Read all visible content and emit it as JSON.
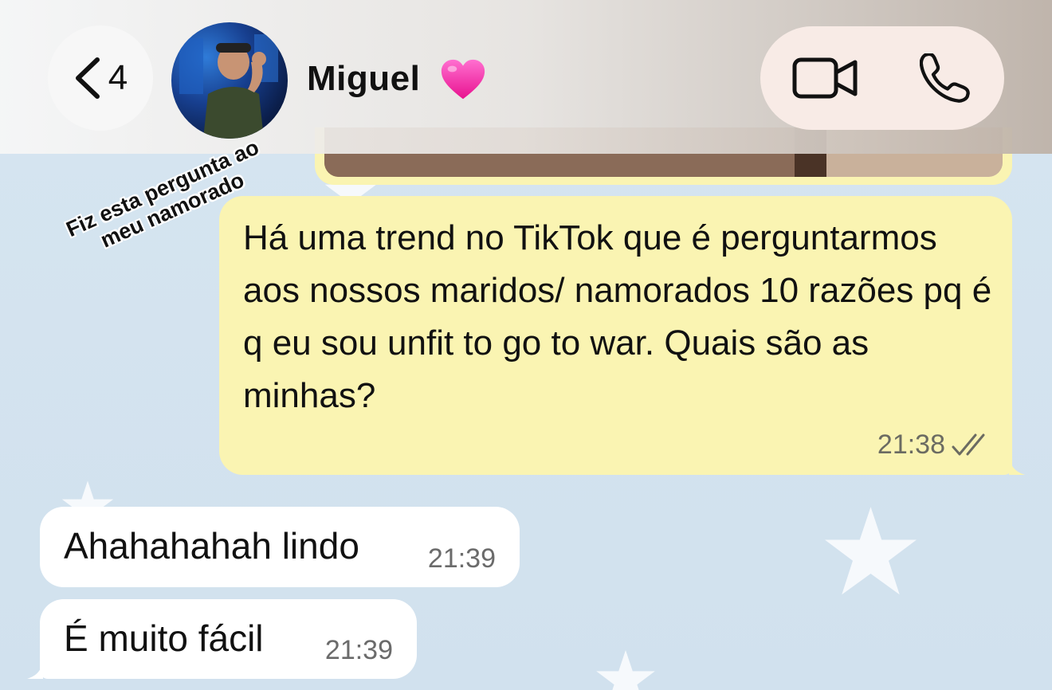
{
  "header": {
    "back_count": "4",
    "contact_name": "Miguel",
    "contact_emoji": "pink-heart"
  },
  "overlay": {
    "caption": "Fiz esta pergunta ao meu namorado"
  },
  "messages": [
    {
      "direction": "outgoing",
      "text": "Há uma trend no TikTok que é perguntarmos aos nossos maridos/ namorados 10 razões pq é q eu sou unfit to go to war. Quais são as minhas?",
      "time": "21:38",
      "status": "read"
    },
    {
      "direction": "incoming",
      "text": "Ahahahahah lindo",
      "time": "21:39"
    },
    {
      "direction": "incoming",
      "text": "É muito fácil",
      "time": "21:39"
    }
  ],
  "colors": {
    "outgoing_bubble": "#faf4b2",
    "incoming_bubble": "#ffffff",
    "chat_background": "#d3e3ef"
  },
  "icons": [
    "chevron-left-icon",
    "video-call-icon",
    "phone-icon",
    "read-receipt-icon",
    "heart-icon"
  ]
}
